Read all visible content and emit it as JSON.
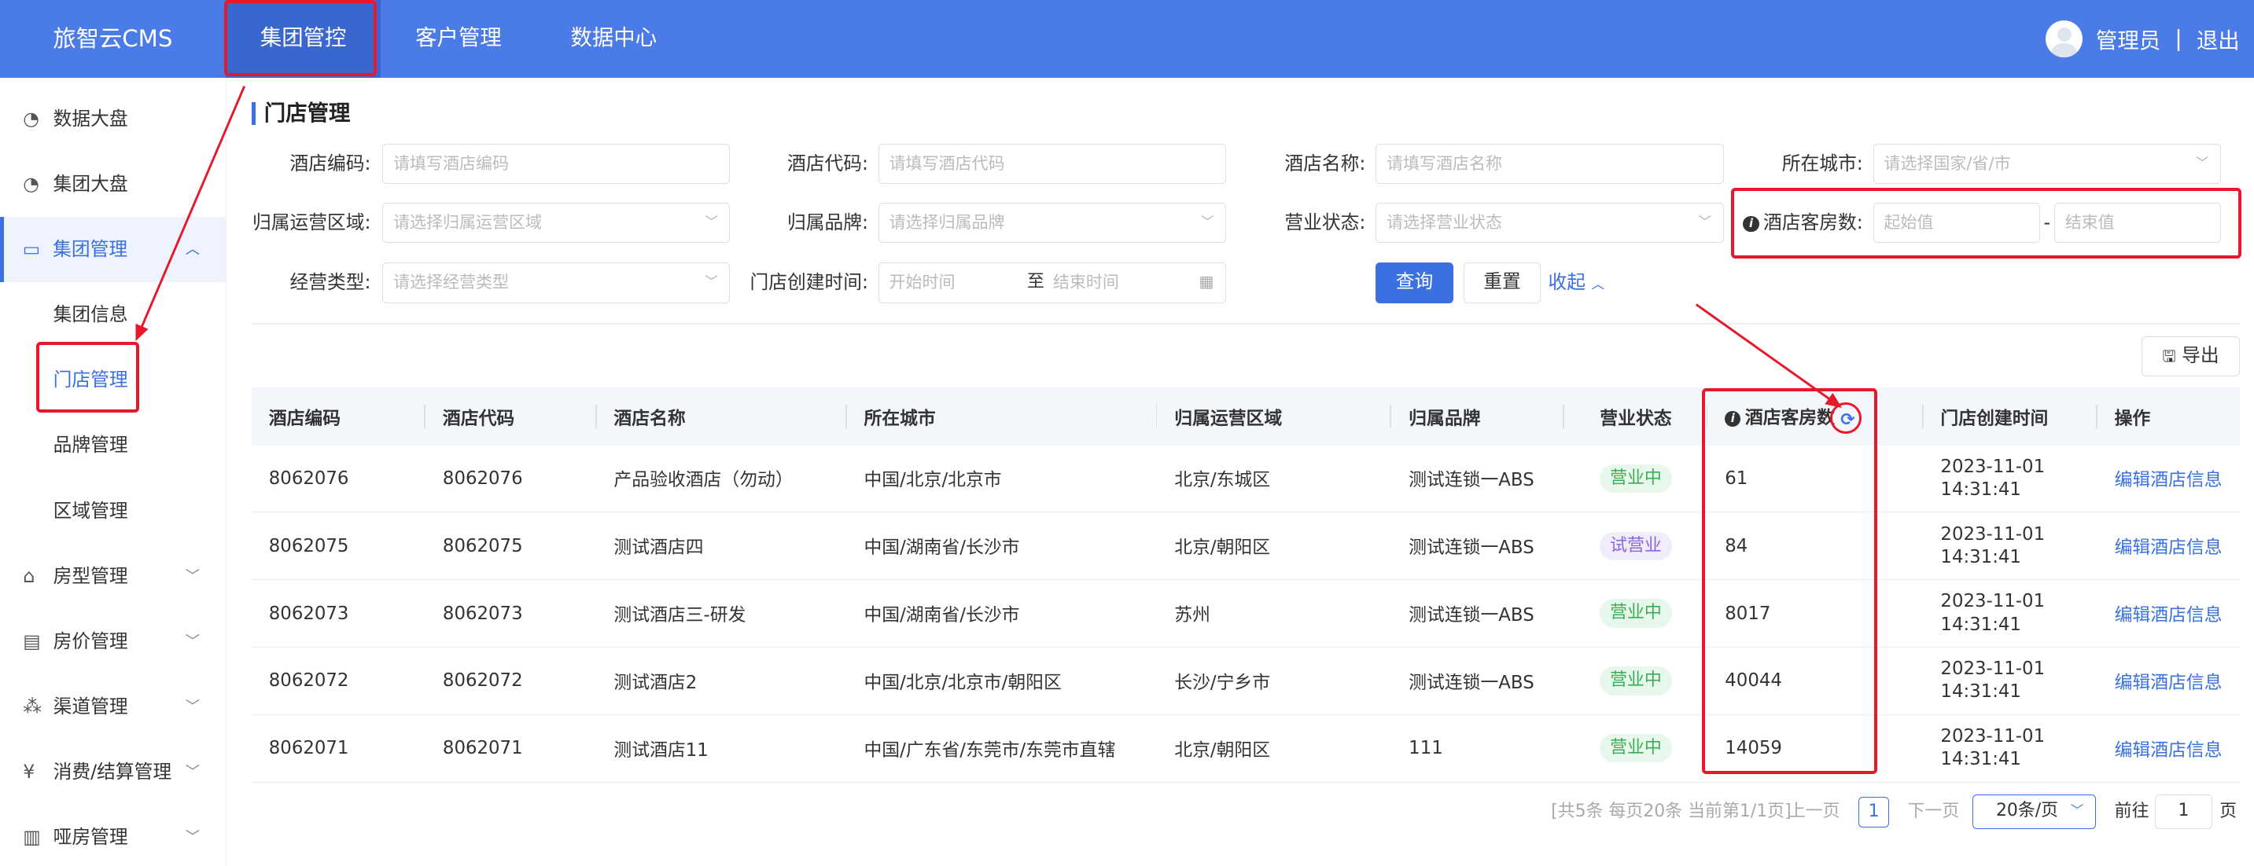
{
  "header": {
    "logo": "旅智云CMS",
    "nav": [
      "集团管控",
      "客户管理",
      "数据中心"
    ],
    "user": "管理员",
    "separator": "|",
    "logout": "退出"
  },
  "sidebar": {
    "items": [
      {
        "label": "数据大盘",
        "icon": "pie-chart-icon"
      },
      {
        "label": "集团大盘",
        "icon": "pie-chart-icon"
      },
      {
        "label": "集团管理",
        "icon": "monitor-icon",
        "open": true
      },
      {
        "label": "房型管理",
        "icon": "home-icon"
      },
      {
        "label": "房价管理",
        "icon": "wallet-icon"
      },
      {
        "label": "渠道管理",
        "icon": "network-icon"
      },
      {
        "label": "消费/结算管理",
        "icon": "yen-icon"
      },
      {
        "label": "哑房管理",
        "icon": "document-icon"
      }
    ],
    "sub_items": [
      "集团信息",
      "门店管理",
      "品牌管理",
      "区域管理"
    ]
  },
  "page": {
    "title": "门店管理"
  },
  "filters": {
    "hotel_code_label": "酒店编码:",
    "hotel_code_placeholder": "请填写酒店编码",
    "hotel_id_label": "酒店代码:",
    "hotel_id_placeholder": "请填写酒店代码",
    "hotel_name_label": "酒店名称:",
    "hotel_name_placeholder": "请填写酒店名称",
    "city_label": "所在城市:",
    "city_placeholder": "请选择国家/省/市",
    "region_label": "归属运营区域:",
    "region_placeholder": "请选择归属运营区域",
    "brand_label": "归属品牌:",
    "brand_placeholder": "请选择归属品牌",
    "status_label": "营业状态:",
    "status_placeholder": "请选择营业状态",
    "rooms_label": "酒店客房数:",
    "rooms_start_placeholder": "起始值",
    "rooms_dash": "-",
    "rooms_end_placeholder": "结束值",
    "biz_type_label": "经营类型:",
    "biz_type_placeholder": "请选择经营类型",
    "created_label": "门店创建时间:",
    "created_start_placeholder": "开始时间",
    "created_to": "至",
    "created_end_placeholder": "结束时间",
    "query_label": "查询",
    "reset_label": "重置",
    "collapse_label": "收起"
  },
  "toolbar": {
    "export_label": "导出"
  },
  "table": {
    "columns": [
      "酒店编码",
      "酒店代码",
      "酒店名称",
      "所在城市",
      "归属运营区域",
      "归属品牌",
      "营业状态",
      "酒店客房数",
      "门店创建时间",
      "操作"
    ],
    "rows": [
      {
        "code": "8062076",
        "id": "8062076",
        "name": "产品验收酒店（勿动）",
        "city": "中国/北京/北京市",
        "region": "北京/东城区",
        "brand": "测试连锁一ABS",
        "status": "营业中",
        "status_type": "open",
        "rooms": "61",
        "date": "2023-11-01",
        "time": "14:31:41",
        "action": "编辑酒店信息"
      },
      {
        "code": "8062075",
        "id": "8062075",
        "name": "测试酒店四",
        "city": "中国/湖南省/长沙市",
        "region": "北京/朝阳区",
        "brand": "测试连锁一ABS",
        "status": "试营业",
        "status_type": "trial",
        "rooms": "84",
        "date": "2023-11-01",
        "time": "14:31:41",
        "action": "编辑酒店信息"
      },
      {
        "code": "8062073",
        "id": "8062073",
        "name": "测试酒店三-研发",
        "city": "中国/湖南省/长沙市",
        "region": "苏州",
        "brand": "测试连锁一ABS",
        "status": "营业中",
        "status_type": "open",
        "rooms": "8017",
        "date": "2023-11-01",
        "time": "14:31:41",
        "action": "编辑酒店信息"
      },
      {
        "code": "8062072",
        "id": "8062072",
        "name": "测试酒店2",
        "city": "中国/北京/北京市/朝阳区",
        "region": "长沙/宁乡市",
        "brand": "测试连锁一ABS",
        "status": "营业中",
        "status_type": "open",
        "rooms": "40044",
        "date": "2023-11-01",
        "time": "14:31:41",
        "action": "编辑酒店信息"
      },
      {
        "code": "8062071",
        "id": "8062071",
        "name": "测试酒店11",
        "city": "中国/广东省/东莞市/东莞市直辖",
        "region": "北京/朝阳区",
        "brand": "111",
        "status": "营业中",
        "status_type": "open",
        "rooms": "14059",
        "date": "2023-11-01",
        "time": "14:31:41",
        "action": "编辑酒店信息"
      }
    ]
  },
  "pagination": {
    "summary": "[共5条 每页20条 当前第1/1页]",
    "prev": "上一页",
    "current": "1",
    "next": "下一页",
    "page_size": "20条/页",
    "goto_label": "前往",
    "goto_value": "1",
    "goto_unit": "页"
  },
  "colors": {
    "header": "#4a7be6",
    "header_active": "#3a66cf",
    "primary": "#3a70e0",
    "annotation": "#e8182b",
    "status_open": "#3dad55",
    "status_trial": "#8b66d8"
  }
}
